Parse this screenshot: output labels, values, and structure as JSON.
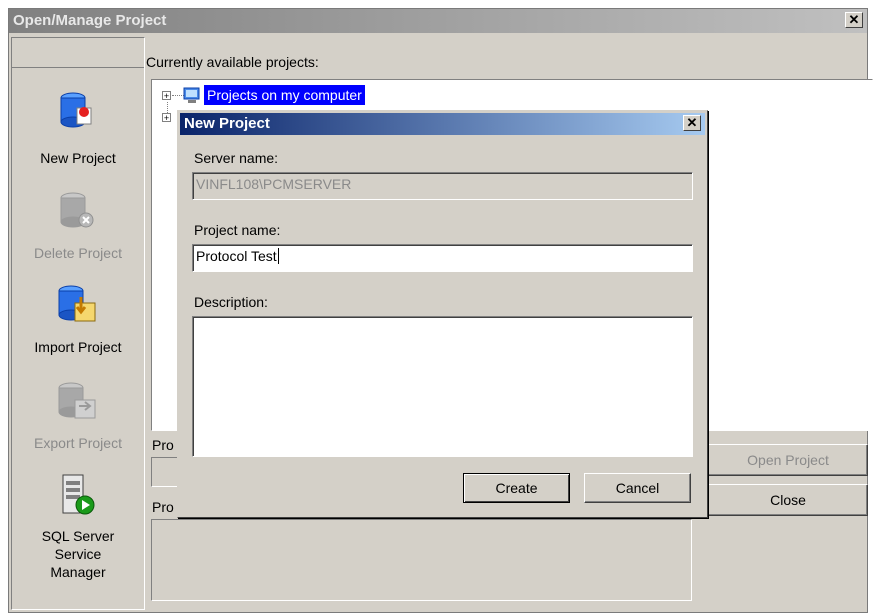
{
  "window": {
    "title": "Open/Manage Project",
    "close_glyph": "✕"
  },
  "sidebar": {
    "items": [
      {
        "label": "New Project",
        "icon": "new-project-icon",
        "enabled": true
      },
      {
        "label": "Delete Project",
        "icon": "delete-project-icon",
        "enabled": false
      },
      {
        "label": "Import Project",
        "icon": "import-project-icon",
        "enabled": true
      },
      {
        "label": "Export Project",
        "icon": "export-project-icon",
        "enabled": false
      },
      {
        "label": "SQL Server Service Manager",
        "icon": "sql-server-icon",
        "enabled": true
      }
    ]
  },
  "main": {
    "available_label": "Currently available projects:",
    "tree": {
      "selected_node": "Projects on my computer"
    },
    "project_path_label": "Pro",
    "project_desc_label": "Pro",
    "open_button": "Open Project",
    "close_button": "Close"
  },
  "dialog": {
    "title": "New Project",
    "server_label": "Server name:",
    "server_value": "VINFL108\\PCMSERVER",
    "project_label": "Project name:",
    "project_value": "Protocol Test",
    "description_label": "Description:",
    "description_value": "",
    "create_button": "Create",
    "cancel_button": "Cancel"
  },
  "colors": {
    "dialog_title": "#0a246a",
    "selection": "#0000ff",
    "face": "#d4d0c8"
  }
}
